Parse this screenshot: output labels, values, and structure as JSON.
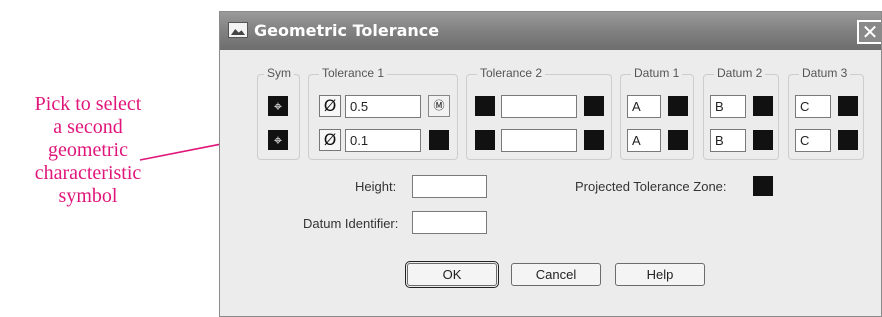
{
  "callout": {
    "lines": [
      "Pick to select",
      "a second",
      "geometric",
      "characteristic",
      "symbol"
    ],
    "color": "#e0167a"
  },
  "dialog": {
    "title": "Geometric Tolerance",
    "close_glyph": "✕",
    "groups": {
      "sym": "Sym",
      "tolerance1": "Tolerance 1",
      "tolerance2": "Tolerance 2",
      "datum1": "Datum 1",
      "datum2": "Datum 2",
      "datum3": "Datum 3"
    },
    "rows": [
      {
        "sym_icon": "position-symbol-icon",
        "tol1_diameter": "Ø",
        "tol1_value": "0.5",
        "tol1_modifier": "Ⓜ",
        "tol2_value": "",
        "datum1": "A",
        "datum2": "B",
        "datum3": "C"
      },
      {
        "sym_icon": "position-symbol-icon",
        "tol1_diameter": "Ø",
        "tol1_value": "0.1",
        "tol2_value": "",
        "datum1": "A",
        "datum2": "B",
        "datum3": "C"
      }
    ],
    "height_label": "Height:",
    "height_value": "",
    "datum_identifier_label": "Datum Identifier:",
    "datum_identifier_value": "",
    "projected_zone_label": "Projected Tolerance Zone:",
    "buttons": {
      "ok": "OK",
      "cancel": "Cancel",
      "help": "Help"
    }
  }
}
